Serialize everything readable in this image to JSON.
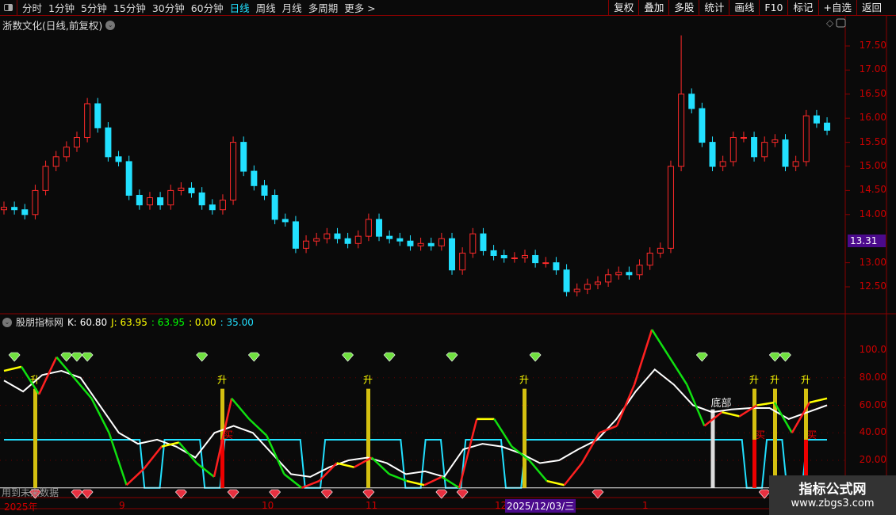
{
  "toolbar": {
    "periods": [
      "分时",
      "1分钟",
      "5分钟",
      "15分钟",
      "30分钟",
      "60分钟",
      "日线",
      "周线",
      "月线",
      "多周期",
      "更多 >"
    ],
    "active": "日线",
    "buttons": [
      "复权",
      "叠加",
      "多股",
      "统计",
      "画线",
      "F10",
      "标记",
      "+自选",
      "返回"
    ]
  },
  "stock_title": "浙数文化(日线,前复权)",
  "price_axis": [
    "17.50",
    "17.00",
    "16.50",
    "16.00",
    "15.50",
    "15.00",
    "14.50",
    "14.00",
    "13.00",
    "12.50"
  ],
  "current_price": "13.31",
  "indicator": {
    "name": "股朋指标网",
    "k_label": "K: 60.80",
    "j_label": "J: 63.95",
    "v3": ": 63.95",
    "v4": ": 0.00",
    "v5": ": 35.00",
    "axis": [
      "100.0",
      "80.00",
      "60.00",
      "40.00",
      "20.00"
    ],
    "rise_label": "升",
    "bottom_label": "底部",
    "buy_label": "买",
    "warning": "用到未来数据"
  },
  "x_axis": {
    "labels": [
      "2025年",
      "9",
      "10",
      "11",
      "12",
      "1"
    ],
    "selected_date": "2025/12/03/三"
  },
  "watermark": {
    "name": "指标公式网",
    "url": "www.zbgs3.com"
  },
  "colors": {
    "up": "#ff2a2a",
    "down": "#22e0ff",
    "k": "#ffffff",
    "cyan": "#22e0ff",
    "grid": "#8b0000"
  },
  "candles_close": [
    14.15,
    14.1,
    14.0,
    14.5,
    15.0,
    15.2,
    15.4,
    15.6,
    16.3,
    15.8,
    15.2,
    15.1,
    14.4,
    14.2,
    14.35,
    14.2,
    14.5,
    14.55,
    14.45,
    14.2,
    14.1,
    14.3,
    15.5,
    14.9,
    14.6,
    14.4,
    13.9,
    13.85,
    13.3,
    13.45,
    13.5,
    13.6,
    13.5,
    13.4,
    13.55,
    13.9,
    13.55,
    13.5,
    13.45,
    13.35,
    13.4,
    13.35,
    13.5,
    12.85,
    13.2,
    13.6,
    13.25,
    13.15,
    13.1,
    13.1,
    13.15,
    13.0,
    13.0,
    12.85,
    12.4,
    12.45,
    12.55,
    12.6,
    12.75,
    12.8,
    12.75,
    12.95,
    13.2,
    13.3,
    15.0,
    16.5,
    16.2,
    15.5,
    15.0,
    15.1,
    15.6,
    15.6,
    15.2,
    15.5,
    15.55,
    15.0,
    15.1,
    16.05,
    15.9,
    15.75
  ],
  "k_series": [
    78,
    70,
    82,
    85,
    80,
    60,
    40,
    32,
    35,
    30,
    22,
    40,
    45,
    40,
    25,
    10,
    8,
    15,
    20,
    22,
    18,
    10,
    12,
    8,
    28,
    32,
    30,
    25,
    18,
    20,
    28,
    35,
    50,
    70,
    86,
    75,
    60,
    55,
    57,
    58,
    58,
    50,
    55,
    60
  ],
  "j_series": [
    85,
    88,
    68,
    95,
    80,
    65,
    40,
    2,
    14,
    30,
    33,
    18,
    8,
    65,
    50,
    38,
    10,
    0,
    5,
    18,
    15,
    22,
    10,
    5,
    2,
    8,
    0,
    50,
    50,
    30,
    20,
    5,
    2,
    18,
    40,
    45,
    75,
    115,
    95,
    75,
    45,
    55,
    52,
    60,
    62,
    40,
    62,
    65
  ],
  "cyan_series": [
    35,
    35,
    35,
    35,
    35,
    35,
    35,
    0,
    35,
    35,
    0,
    35,
    35,
    35,
    35,
    0,
    35,
    35,
    35,
    35,
    0,
    35,
    0,
    35,
    35,
    0,
    35,
    35,
    35,
    35,
    35,
    35,
    35,
    35,
    35,
    35,
    35,
    0,
    35,
    0,
    35,
    35
  ],
  "buy_markers_x_index": [
    1,
    6,
    7,
    8,
    19,
    24,
    33,
    37,
    43,
    51,
    67,
    74,
    75
  ],
  "sell_markers_x_index": [
    3,
    7,
    8,
    17,
    22,
    26,
    31,
    35,
    42,
    44,
    57,
    73,
    78
  ],
  "rise_bars_index": [
    3,
    21,
    35,
    50,
    72,
    74,
    77
  ],
  "bottom_bar_index": 68
}
